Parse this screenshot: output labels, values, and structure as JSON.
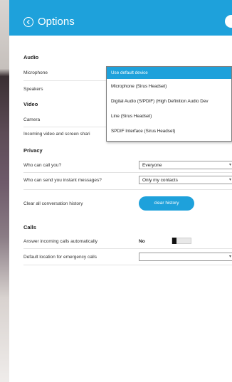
{
  "header": {
    "title": "Options"
  },
  "audio": {
    "section_label": "Audio",
    "microphone_label": "Microphone",
    "speakers_label": "Speakers"
  },
  "video": {
    "section_label": "Video",
    "camera_label": "Camera",
    "incoming_label": "Incoming video and screen shari"
  },
  "dropdown": {
    "options": [
      "Use default device",
      "Microphone (Sirus Headset)",
      "Digital Audio (S/PDIF) (High Definition Audio Dev",
      "Line (Sirus Headset)",
      "SPDIF Interface (Sirus Headset)"
    ],
    "selected_index": 0
  },
  "privacy": {
    "section_label": "Privacy",
    "call_label": "Who can call you?",
    "call_value": "Everyone",
    "im_label": "Who can send you instant messages?",
    "im_value": "Only my contacts",
    "clear_label": "Clear all conversation history",
    "clear_button": "clear history"
  },
  "calls": {
    "section_label": "Calls",
    "answer_label": "Answer incoming calls automatically",
    "answer_value": "No",
    "answer_enabled": false,
    "emergency_label": "Default location for emergency calls",
    "emergency_value": ""
  },
  "colors": {
    "accent": "#1ea1db",
    "text": "#222222"
  },
  "icons": {
    "back": "back-arrow-icon",
    "dropdown": "chevron-down-icon"
  }
}
